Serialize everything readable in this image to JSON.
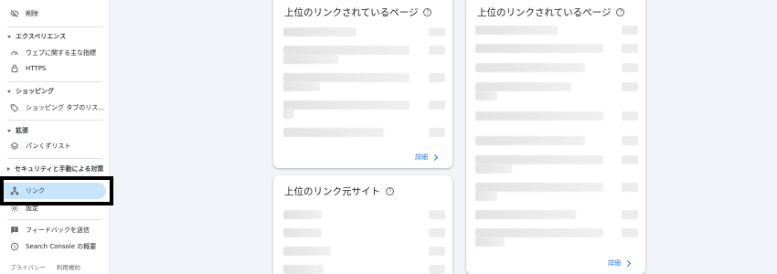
{
  "sidebar": {
    "delete_label": "削除",
    "sections": {
      "experience": "エクスペリエンス",
      "shopping": "ショッピング",
      "enhancements": "拡張",
      "security": "セキュリティと手動による対策"
    },
    "items": {
      "core_web_vitals": "ウェブに関する主な指標",
      "https": "HTTPS",
      "shopping_tab": "ショッピング タブのリス…",
      "breadcrumbs": "パンくずリスト",
      "links": "リンク",
      "settings": "設定",
      "feedback": "フィードバックを送信",
      "about": "Search Console の概要"
    },
    "footer": {
      "privacy": "プライバシー",
      "terms": "利用規約"
    }
  },
  "cards": {
    "top_linked_pages_1": {
      "title": "上位のリンクされているページ",
      "details": "詳細"
    },
    "top_linked_pages_2": {
      "title": "上位のリンクされているページ",
      "details": "詳細"
    },
    "top_linking_sites": {
      "title": "上位のリンク元サイト"
    }
  },
  "colors": {
    "active_bg": "#c9e5fb",
    "link_blue": "#1a73e8",
    "page_bg": "#f1f4f9"
  }
}
